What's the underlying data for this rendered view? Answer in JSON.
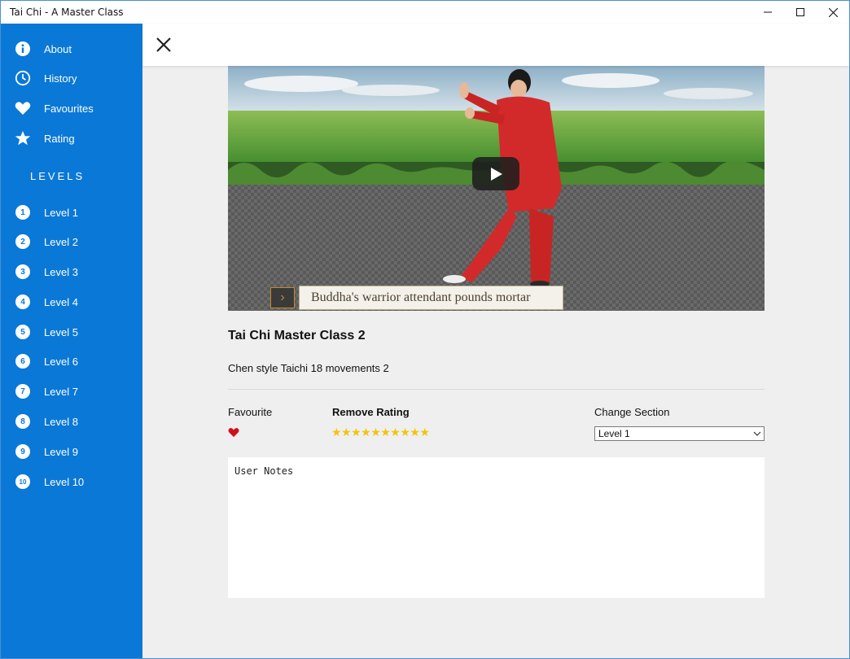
{
  "window": {
    "title": "Tai Chi - A Master Class"
  },
  "sidebar": {
    "items": [
      {
        "label": "About",
        "icon": "info-icon"
      },
      {
        "label": "History",
        "icon": "clock-icon"
      },
      {
        "label": "Favourites",
        "icon": "heart-icon"
      },
      {
        "label": "Rating",
        "icon": "star-icon"
      }
    ],
    "levels_header": "LEVELS",
    "levels": [
      {
        "num": "1",
        "label": "Level 1"
      },
      {
        "num": "2",
        "label": "Level 2"
      },
      {
        "num": "3",
        "label": "Level 3"
      },
      {
        "num": "4",
        "label": "Level 4"
      },
      {
        "num": "5",
        "label": "Level 5"
      },
      {
        "num": "6",
        "label": "Level 6"
      },
      {
        "num": "7",
        "label": "Level 7"
      },
      {
        "num": "8",
        "label": "Level 8"
      },
      {
        "num": "9",
        "label": "Level 9"
      },
      {
        "num": "10",
        "label": "Level 10"
      }
    ]
  },
  "video": {
    "caption": "Buddha's warrior attendant pounds mortar",
    "title": "Tai Chi Master Class 2",
    "description": "Chen style Taichi 18 movements 2"
  },
  "details": {
    "favourite_label": "Favourite",
    "favourite_active": true,
    "rating_label": "Remove Rating",
    "rating_stars": "★★★★★★★★★★",
    "rating_value": 10,
    "rating_max": 10,
    "section_label": "Change Section",
    "section_value": "Level 1"
  },
  "notes": {
    "placeholder": "User Notes"
  },
  "colors": {
    "accent": "#0a78d7",
    "star": "#f2c40c",
    "heart": "#d0101a"
  }
}
